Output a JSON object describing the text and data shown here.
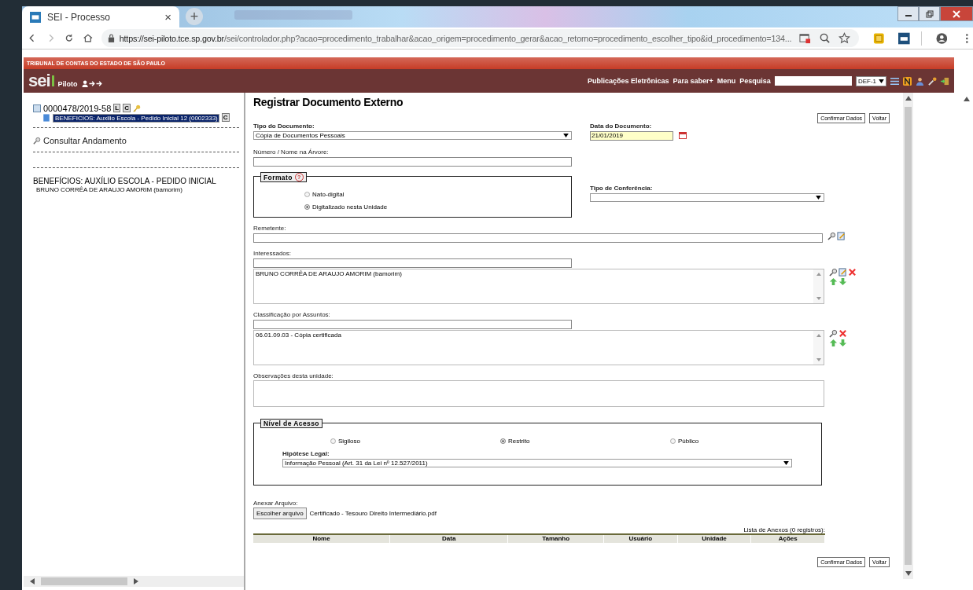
{
  "browser": {
    "tab_title": "SEI - Processo",
    "tab_close": "×",
    "new_tab": "+",
    "url_host": "https://sei-piloto.tce.sp.gov.br",
    "url_path": "/sei/controlador.php?acao=procedimento_trabalhar&acao_origem=procedimento_gerar&acao_retorno=procedimento_escolher_tipo&id_procedimento=134..."
  },
  "header": {
    "organization": "TRIBUNAL DE CONTAS DO ESTADO DE SÃO PAULO",
    "logo": "sei",
    "environment": "Piloto",
    "links": [
      "Publicações Eletrônicas",
      "Para saber+",
      "Menu",
      "Pesquisa"
    ],
    "unit": "DEF-1"
  },
  "tree": {
    "process": "0000478/2019-58",
    "process_badges": [
      "L",
      "C"
    ],
    "document": {
      "label": "BENEFICIOS: Auxilio Escola - Pedido Inicial 12 (0002333)",
      "selected": true,
      "badge": "C"
    },
    "consult": "Consultar Andamento",
    "process_type": "BENEFÍCIOS: AUXÍLIO ESCOLA - PEDIDO INICIAL",
    "interested": "BRUNO CORRÊA DE ARAUJO AMORIM (bamorim)"
  },
  "form": {
    "title": "Registrar Documento Externo",
    "buttons": [
      "Confirmar Dados",
      "Voltar"
    ],
    "tipo_label": "Tipo do Documento:",
    "tipo_value": "Cópia de Documentos Pessoais",
    "data_label": "Data do Documento:",
    "data_value": "21/01/2019",
    "numero_label": "Número / Nome na Árvore:",
    "formato": {
      "legend": "Formato",
      "help": "?",
      "options": [
        {
          "label": "Nato-digital",
          "selected": false
        },
        {
          "label": "Digitalizado nesta Unidade",
          "selected": true
        }
      ]
    },
    "conferencia_label": "Tipo de Conferência:",
    "remetente_label": "Remetente:",
    "interessados_label": "Interessados:",
    "interessados_items": [
      "BRUNO CORRÊA DE ARAUJO AMORIM (bamorim)"
    ],
    "assuntos_label": "Classificação por Assuntos:",
    "assuntos_items": [
      "06.01.09.03 - Cópia certificada"
    ],
    "observacoes_label": "Observações desta unidade:",
    "nivel": {
      "legend": "Nível de Acesso",
      "options": [
        {
          "label": "Sigiloso",
          "selected": false
        },
        {
          "label": "Restrito",
          "selected": true
        },
        {
          "label": "Público",
          "selected": false
        }
      ],
      "hipotese_label": "Hipótese Legal:",
      "hipotese_value": "Informação Pessoal (Art. 31 da Lei nº 12.527/2011)"
    },
    "anexar_label": "Anexar Arquivo:",
    "file_button": "Escolher arquivo",
    "file_name": "Certificado - Tesouro Direito Intermediário.pdf",
    "anexos_caption": "Lista de Anexos (0 registros):",
    "anexos_columns": [
      "Nome",
      "Data",
      "Tamanho",
      "Usuário",
      "Unidade",
      "Ações"
    ],
    "bottom_buttons": [
      "Confirmar Dados",
      "Voltar"
    ]
  }
}
